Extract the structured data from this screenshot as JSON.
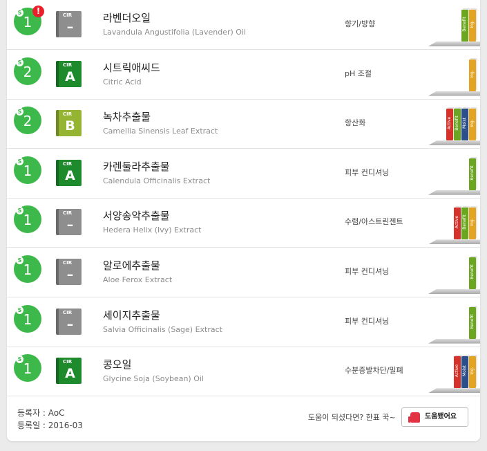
{
  "ingredients": [
    {
      "ewg": "1",
      "alert": "!",
      "cir": "–",
      "cir_color": "#8e8e8e",
      "name_ko": "라벤더오일",
      "name_en": "Lavandula Angustifolia (Lavender) Oil",
      "purpose": "향기/방향",
      "books": [
        {
          "label": "Benefit",
          "color": "#6aa61f"
        },
        {
          "label": "Ing.",
          "color": "#e3a521"
        }
      ]
    },
    {
      "ewg": "2",
      "cir": "A",
      "cir_color": "#1d8a2c",
      "name_ko": "시트릭애씨드",
      "name_en": "Citric Acid",
      "purpose": "pH 조절",
      "books": [
        {
          "label": "Ing.",
          "color": "#e3a521"
        }
      ]
    },
    {
      "ewg": "2",
      "cir": "B",
      "cir_color": "#95b432",
      "name_ko": "녹차추출물",
      "name_en": "Camellia Sinensis Leaf Extract",
      "purpose": "항산화",
      "books": [
        {
          "label": "Active",
          "color": "#d4322a"
        },
        {
          "label": "Benefit",
          "color": "#6aa61f"
        },
        {
          "label": "Moist",
          "color": "#2c4f8a"
        },
        {
          "label": "Ing.",
          "color": "#e3a521"
        }
      ]
    },
    {
      "ewg": "1",
      "cir": "A",
      "cir_color": "#1d8a2c",
      "name_ko": "카렌둘라추출물",
      "name_en": "Calendula Officinalis Extract",
      "purpose": "피부 컨디셔닝",
      "books": [
        {
          "label": "Benefit",
          "color": "#6aa61f"
        }
      ]
    },
    {
      "ewg": "1",
      "cir": "–",
      "cir_color": "#8e8e8e",
      "name_ko": "서양송악추출물",
      "name_en": "Hedera Helix (Ivy) Extract",
      "purpose": "수렴/아스트린젠트",
      "books": [
        {
          "label": "Active",
          "color": "#d4322a"
        },
        {
          "label": "Benefit",
          "color": "#6aa61f"
        },
        {
          "label": "Ing.",
          "color": "#e3a521"
        }
      ]
    },
    {
      "ewg": "1",
      "cir": "–",
      "cir_color": "#8e8e8e",
      "name_ko": "알로에추출물",
      "name_en": "Aloe Ferox Extract",
      "purpose": "피부 컨디셔닝",
      "books": [
        {
          "label": "Benefit",
          "color": "#6aa61f"
        }
      ]
    },
    {
      "ewg": "1",
      "cir": "–",
      "cir_color": "#8e8e8e",
      "name_ko": "세이지추출물",
      "name_en": "Salvia Officinalis (Sage) Extract",
      "purpose": "피부 컨디셔닝",
      "books": [
        {
          "label": "Benefit",
          "color": "#6aa61f"
        }
      ]
    },
    {
      "ewg": "1",
      "cir": "A",
      "cir_color": "#1d8a2c",
      "name_ko": "콩오일",
      "name_en": "Glycine Soja (Soybean) Oil",
      "purpose": "수분증발차단/밀폐",
      "books": [
        {
          "label": "Active",
          "color": "#d4322a"
        },
        {
          "label": "Moist",
          "color": "#2c4f8a"
        },
        {
          "label": "Ing.",
          "color": "#e3a521"
        }
      ]
    }
  ],
  "cir_label": "CIR",
  "ewg_mark": "S",
  "footer": {
    "registrant": "등록자 : AoC",
    "registered_date": "등록일 : 2016-03",
    "help_question": "도움이 되셨다면? 한표 꾹~",
    "help_button": "도움됐어요"
  },
  "colors": {
    "ewg_green": "#3cb94a",
    "alert_red": "#e8202a"
  }
}
